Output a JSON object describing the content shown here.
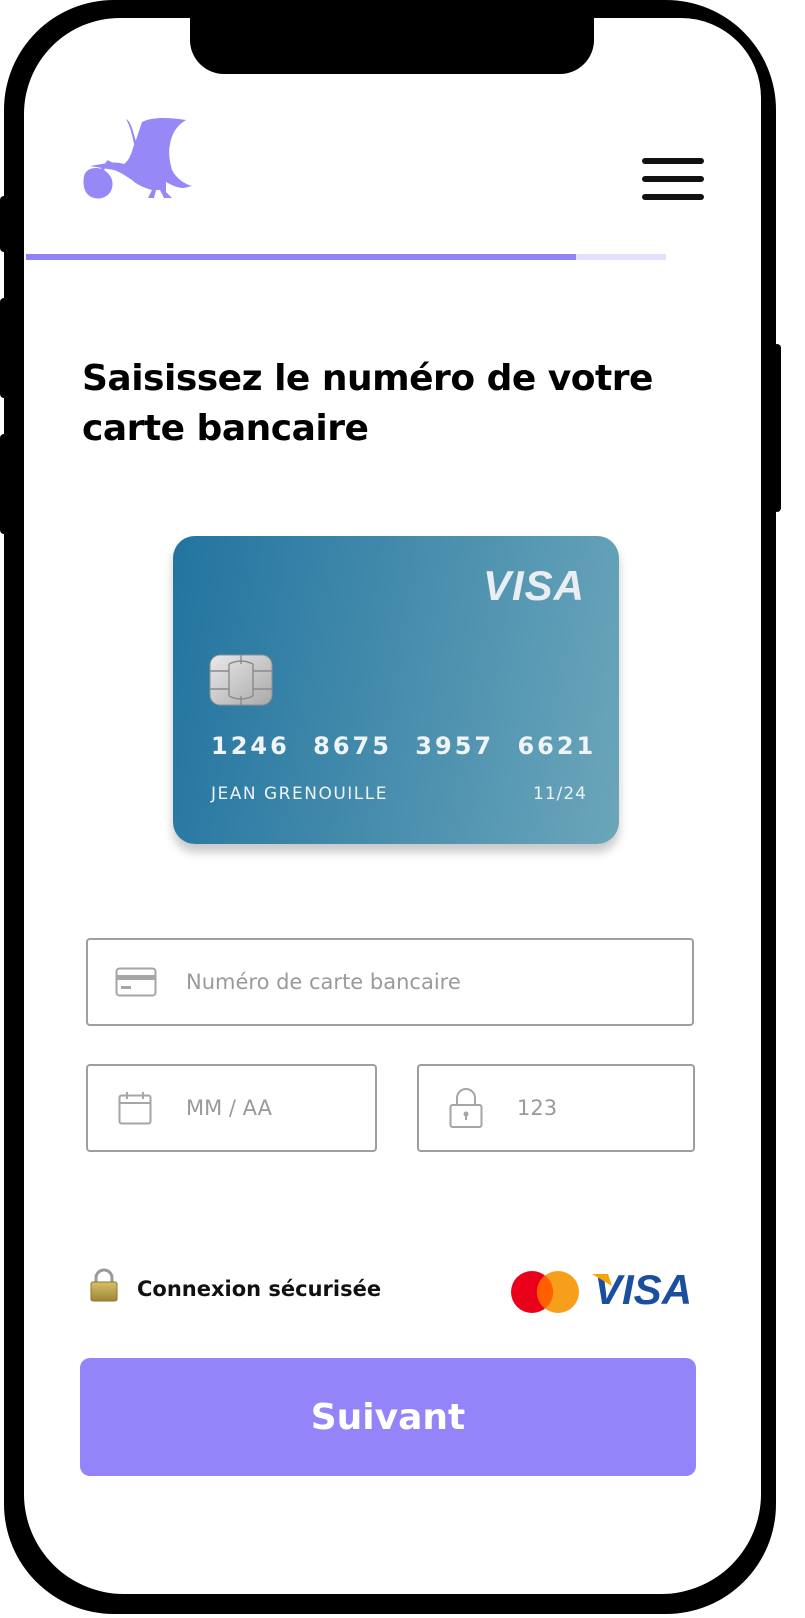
{
  "header": {
    "logo_icon": "stork-carrying-baby-icon",
    "menu_icon": "hamburger-menu-icon",
    "progress": 0.86
  },
  "page": {
    "title": "Saisissez le numéro de votre carte bancaire"
  },
  "card_preview": {
    "brand": "VISA",
    "chip_icon": "card-chip-icon",
    "number": "1246 8675 3957 6621",
    "holder": "JEAN GRENOUILLE",
    "expiry": "11/24"
  },
  "form": {
    "card_number": {
      "icon": "credit-card-icon",
      "placeholder": "Numéro de carte bancaire",
      "value": ""
    },
    "expiry": {
      "icon": "calendar-icon",
      "placeholder": "MM / AA",
      "value": ""
    },
    "cvc": {
      "icon": "padlock-icon",
      "placeholder": "123",
      "value": ""
    }
  },
  "footer": {
    "secure_icon": "gold-lock-icon",
    "secure_text": "Connexion sécurisée",
    "payment_logos": [
      "mastercard-logo",
      "visa-logo"
    ],
    "visa_text": "VISA",
    "submit_label": "Suivant"
  },
  "colors": {
    "accent": "#9384fa",
    "progress_fill": "#8f83f5",
    "progress_track": "#e3e0fd",
    "card_gradient_start": "#2274a0",
    "card_gradient_end": "#6ba6ba",
    "visa_blue": "#1a4e9e"
  }
}
